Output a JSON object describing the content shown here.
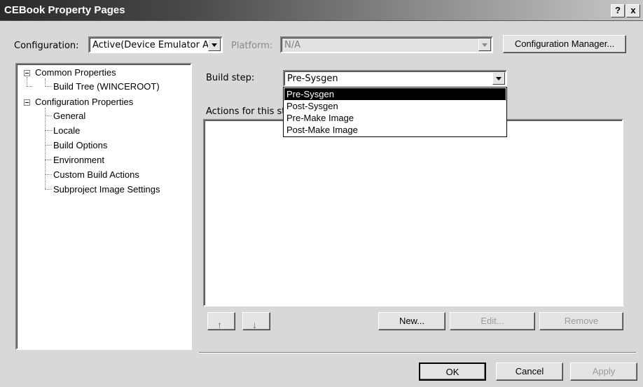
{
  "window": {
    "title": "CEBook Property Pages",
    "help_label": "?",
    "close_label": "x"
  },
  "config": {
    "configuration_label": "Configuration:",
    "configuration_value": "Active(Device Emulator A",
    "platform_label": "Platform:",
    "platform_value": "N/A",
    "manager_button": "Configuration Manager..."
  },
  "tree": {
    "common": "Common Properties",
    "build_tree": "Build Tree (WINCEROOT)",
    "configuration": "Configuration Properties",
    "children": [
      "General",
      "Locale",
      "Build Options",
      "Environment",
      "Custom Build Actions",
      "Subproject Image Settings"
    ]
  },
  "build_step": {
    "label": "Build step:",
    "value": "Pre-Sysgen",
    "options": [
      "Pre-Sysgen",
      "Post-Sysgen",
      "Pre-Make Image",
      "Post-Make Image"
    ],
    "selected_index": 0
  },
  "actions": {
    "label": "Actions for this ste",
    "up_icon": "up-arrow-icon",
    "down_icon": "down-arrow-icon",
    "new_button": "New...",
    "edit_button": "Edit...",
    "remove_button": "Remove"
  },
  "footer": {
    "ok": "OK",
    "cancel": "Cancel",
    "apply": "Apply"
  }
}
